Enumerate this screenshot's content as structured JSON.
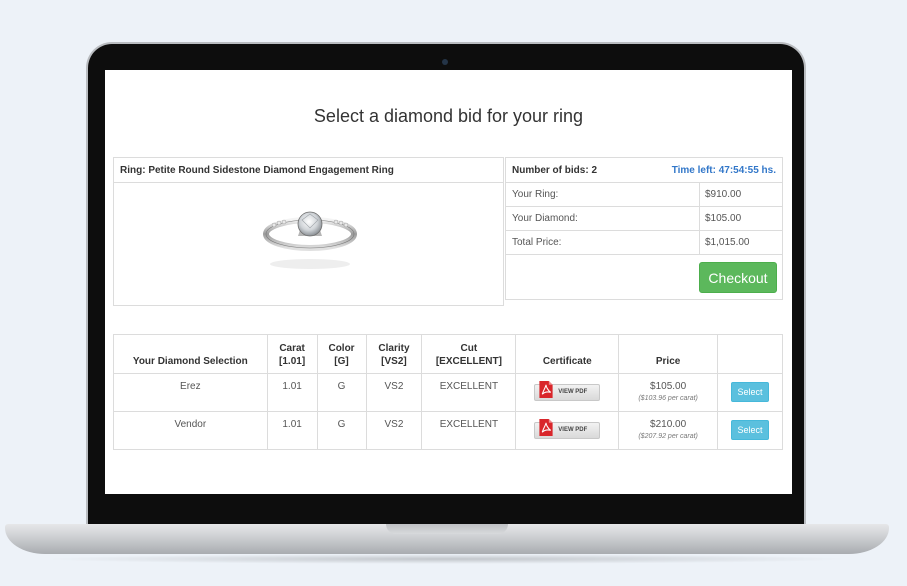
{
  "page": {
    "title": "Select a diamond bid for your ring"
  },
  "product": {
    "heading": "Ring: Petite Round Sidestone Diamond Engagement Ring"
  },
  "bid_summary": {
    "count_label": "Number of bids: 2",
    "time_left": "Time left: 47:54:55 hs.",
    "rows": [
      {
        "label": "Your Ring:",
        "value": "$910.00"
      },
      {
        "label": "Your Diamond:",
        "value": "$105.00"
      },
      {
        "label": "Total Price:",
        "value": "$1,015.00"
      }
    ],
    "checkout_label": "Checkout"
  },
  "table": {
    "headers": {
      "selection": "Your Diamond Selection",
      "carat_line1": "Carat",
      "carat_line2": "[1.01]",
      "color_line1": "Color",
      "color_line2": "[G]",
      "clarity_line1": "Clarity",
      "clarity_line2": "[VS2]",
      "cut_line1": "Cut",
      "cut_line2": "[EXCELLENT]",
      "certificate": "Certificate",
      "price": "Price"
    },
    "rows": [
      {
        "selection": "Erez",
        "carat": "1.01",
        "color": "G",
        "clarity": "VS2",
        "cut": "EXCELLENT",
        "cert_label": "VIEW PDF",
        "price": "$105.00",
        "per_carat": "($103.96 per carat)",
        "select_label": "Select"
      },
      {
        "selection": "Vendor",
        "carat": "1.01",
        "color": "G",
        "clarity": "VS2",
        "cut": "EXCELLENT",
        "cert_label": "VIEW PDF",
        "price": "$210.00",
        "per_carat": "($207.92 per carat)",
        "select_label": "Select"
      }
    ]
  },
  "colors": {
    "checkout": "#5cb85c",
    "select": "#5bc0de",
    "time_left": "#3277c9",
    "pdf_icon": "#d9262b"
  },
  "icons": {
    "certificate": "pdf-icon",
    "product": "diamond-ring-image"
  }
}
